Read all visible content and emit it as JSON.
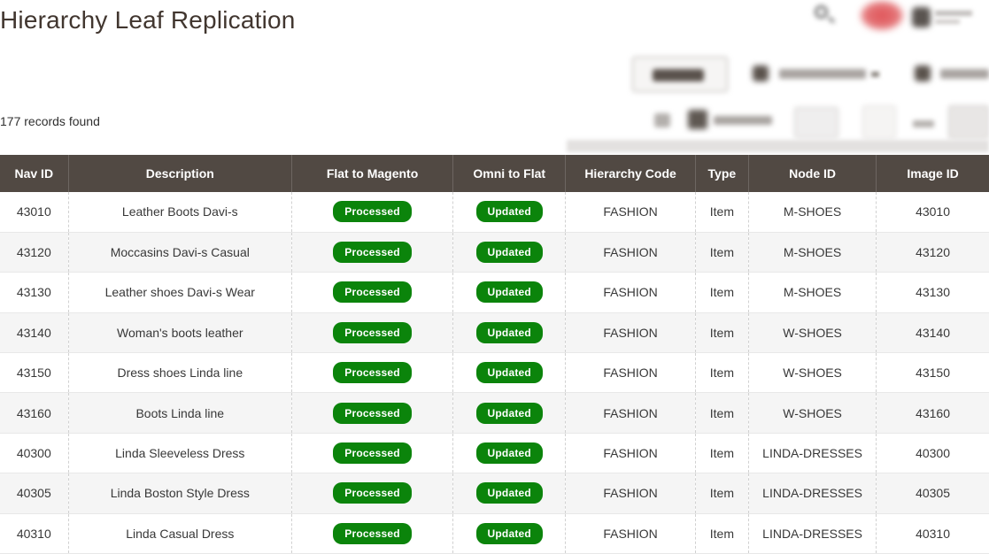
{
  "page": {
    "title": "Hierarchy Leaf Replication",
    "records_found": "177 records found"
  },
  "top_icons": [
    {
      "name": "search-icon"
    },
    {
      "name": "notifications-badge-icon",
      "color": "#e05458"
    },
    {
      "name": "account-icon"
    }
  ],
  "colors": {
    "table_header_bg": "#514943",
    "status_badge_green": "#0b840b",
    "row_alt_bg": "#f5f5f5",
    "title_text": "#41362f"
  },
  "table": {
    "columns": [
      "Nav ID",
      "Description",
      "Flat to Magento",
      "Omni to Flat",
      "Hierarchy Code",
      "Type",
      "Node ID",
      "Image ID"
    ],
    "rows": [
      {
        "nav_id": "43010",
        "description": "Leather Boots Davi-s",
        "flat_to_magento": "Processed",
        "omni_to_flat": "Updated",
        "hierarchy_code": "FASHION",
        "type": "Item",
        "node_id": "M-SHOES",
        "image_id": "43010"
      },
      {
        "nav_id": "43120",
        "description": "Moccasins Davi-s Casual",
        "flat_to_magento": "Processed",
        "omni_to_flat": "Updated",
        "hierarchy_code": "FASHION",
        "type": "Item",
        "node_id": "M-SHOES",
        "image_id": "43120"
      },
      {
        "nav_id": "43130",
        "description": "Leather shoes Davi-s Wear",
        "flat_to_magento": "Processed",
        "omni_to_flat": "Updated",
        "hierarchy_code": "FASHION",
        "type": "Item",
        "node_id": "M-SHOES",
        "image_id": "43130"
      },
      {
        "nav_id": "43140",
        "description": "Woman's boots leather",
        "flat_to_magento": "Processed",
        "omni_to_flat": "Updated",
        "hierarchy_code": "FASHION",
        "type": "Item",
        "node_id": "W-SHOES",
        "image_id": "43140"
      },
      {
        "nav_id": "43150",
        "description": "Dress shoes Linda line",
        "flat_to_magento": "Processed",
        "omni_to_flat": "Updated",
        "hierarchy_code": "FASHION",
        "type": "Item",
        "node_id": "W-SHOES",
        "image_id": "43150"
      },
      {
        "nav_id": "43160",
        "description": "Boots Linda line",
        "flat_to_magento": "Processed",
        "omni_to_flat": "Updated",
        "hierarchy_code": "FASHION",
        "type": "Item",
        "node_id": "W-SHOES",
        "image_id": "43160"
      },
      {
        "nav_id": "40300",
        "description": "Linda Sleeveless Dress",
        "flat_to_magento": "Processed",
        "omni_to_flat": "Updated",
        "hierarchy_code": "FASHION",
        "type": "Item",
        "node_id": "LINDA-DRESSES",
        "image_id": "40300"
      },
      {
        "nav_id": "40305",
        "description": "Linda Boston Style Dress",
        "flat_to_magento": "Processed",
        "omni_to_flat": "Updated",
        "hierarchy_code": "FASHION",
        "type": "Item",
        "node_id": "LINDA-DRESSES",
        "image_id": "40305"
      },
      {
        "nav_id": "40310",
        "description": "Linda Casual Dress",
        "flat_to_magento": "Processed",
        "omni_to_flat": "Updated",
        "hierarchy_code": "FASHION",
        "type": "Item",
        "node_id": "LINDA-DRESSES",
        "image_id": "40310"
      }
    ]
  }
}
